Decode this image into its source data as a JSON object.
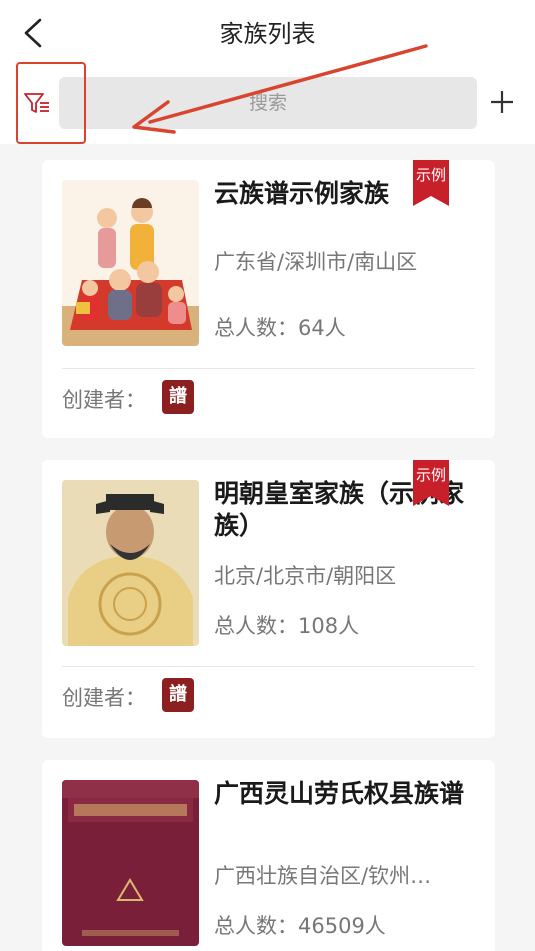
{
  "header": {
    "title": "家族列表"
  },
  "search": {
    "placeholder": "搜索"
  },
  "families": [
    {
      "name": "云族谱示例家族",
      "location": "广东省/深圳市/南山区",
      "count": "总人数：64人",
      "creator_label": "创建者：",
      "badge": "示例",
      "seal": "譜"
    },
    {
      "name": "明朝皇室家族（示例家族）",
      "location": "北京/北京市/朝阳区",
      "count": "总人数：108人",
      "creator_label": "创建者：",
      "badge": "示例",
      "seal": "譜"
    },
    {
      "name": "广西灵山劳氏权县族谱",
      "location": "广西壮族自治区/钦州…",
      "count": "总人数：46509人"
    }
  ],
  "colors": {
    "accent": "#c8202a",
    "highlight": "#d9442e"
  }
}
